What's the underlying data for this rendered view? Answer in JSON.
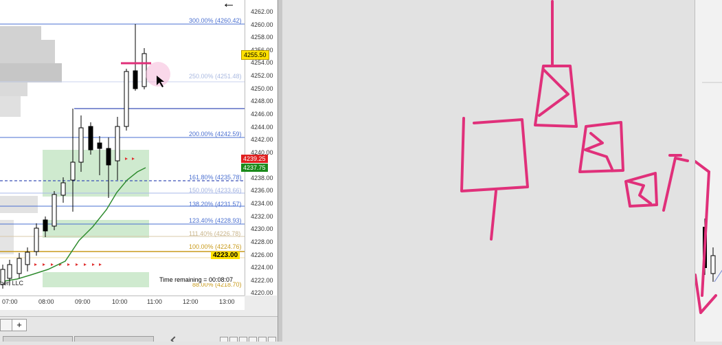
{
  "chart": {
    "price_ticks": [
      "4262.00",
      "4260.00",
      "4258.00",
      "4256.00",
      "4254.00",
      "4252.00",
      "4250.00",
      "4248.00",
      "4246.00",
      "4244.00",
      "4242.00",
      "4240.00",
      "4238.00",
      "4236.00",
      "4234.00",
      "4232.00",
      "4230.00",
      "4228.00",
      "4226.00",
      "4224.00",
      "4222.00",
      "4220.00"
    ],
    "time_ticks": [
      "07:00",
      "08:00",
      "09:00",
      "10:00",
      "11:00",
      "12:00",
      "13:00"
    ],
    "fib_labels": [
      {
        "text": "300.00% (4260.42)",
        "color": "#4a6fd0"
      },
      {
        "text": "250.00% (4251.48)",
        "color": "#a9b9e0"
      },
      {
        "text": "200.00% (4242.59)",
        "color": "#4a6fd0"
      },
      {
        "text": "161.80% (4235.78)",
        "color": "#4a6fd0"
      },
      {
        "text": "150.00% (4233.66)",
        "color": "#9fb0e0"
      },
      {
        "text": "138.20% (4231.57)",
        "color": "#4a6fd0"
      },
      {
        "text": "123.40% (4228.93)",
        "color": "#4a6fd0"
      },
      {
        "text": "111.40% (4226.78)",
        "color": "#c8b48a"
      },
      {
        "text": "100.00% (4224.76)",
        "color": "#c89a1a"
      },
      {
        "text": "88.00% (4218.70)",
        "color": "#c89a1a"
      }
    ],
    "price_badges": {
      "current": "4255.50",
      "red": "4239.25",
      "green": "4237.75",
      "yellow": "4223.00"
    },
    "time_remaining": "Time remaining = 00:08:07",
    "copyright_fragment": "ber, LLC",
    "add_tab_symbol": "+",
    "back_arrow_symbol": "←",
    "accent_colors": {
      "fib": "#4a6fd0",
      "ema": "#2e8b2e",
      "annotation": "#e0307a"
    }
  }
}
